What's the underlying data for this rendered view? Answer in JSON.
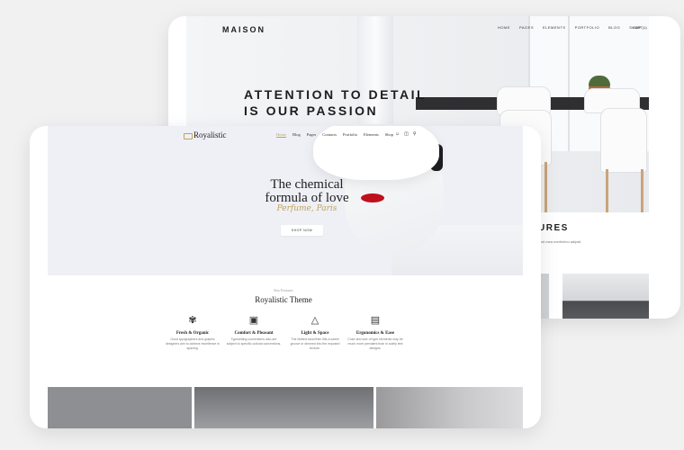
{
  "maison": {
    "logo": "MAISON",
    "nav": [
      "HOME",
      "PAGES",
      "ELEMENTS",
      "PORTFOLIO",
      "BLOG",
      "SHOP"
    ],
    "cart": "CART(1)",
    "headline_line1": "ATTENTION TO DETAIL",
    "headline_line2": "IS OUR PASSION",
    "features_heading": "URES",
    "features_text": "ipsit mea mertinimo adipsit"
  },
  "royal": {
    "brand": "Royalistic",
    "nav": [
      "Home",
      "Blog",
      "Pages",
      "Contacts",
      "Portfolio",
      "Elements",
      "Shop"
    ],
    "hero_title_line1": "The chemical",
    "hero_title_line2": "formula of love",
    "hero_script": "Perfume, Paris",
    "shop_button": "SHOP NOW",
    "kicker": "Key Features",
    "section_title": "Royalistic Theme",
    "features": [
      {
        "title": "Fresh & Organic",
        "desc": "Good typographers and graphic designers aim to achieve excellence in spacing."
      },
      {
        "title": "Comfort & Pleasant",
        "desc": "Typesetting conventions also are subject to specific cultural conventions."
      },
      {
        "title": "Light & Space",
        "desc": "The blotted sand then lifts a sweet groove or dimmed into the exposed texture."
      },
      {
        "title": "Ergonomics & Ease",
        "desc": "Color and size of type elements may be much more prevalent than in solely text designs."
      }
    ]
  },
  "colors": {
    "accent_gold": "#c2a25b",
    "lips_red": "#c0101d",
    "background": "#f1f1f2"
  }
}
